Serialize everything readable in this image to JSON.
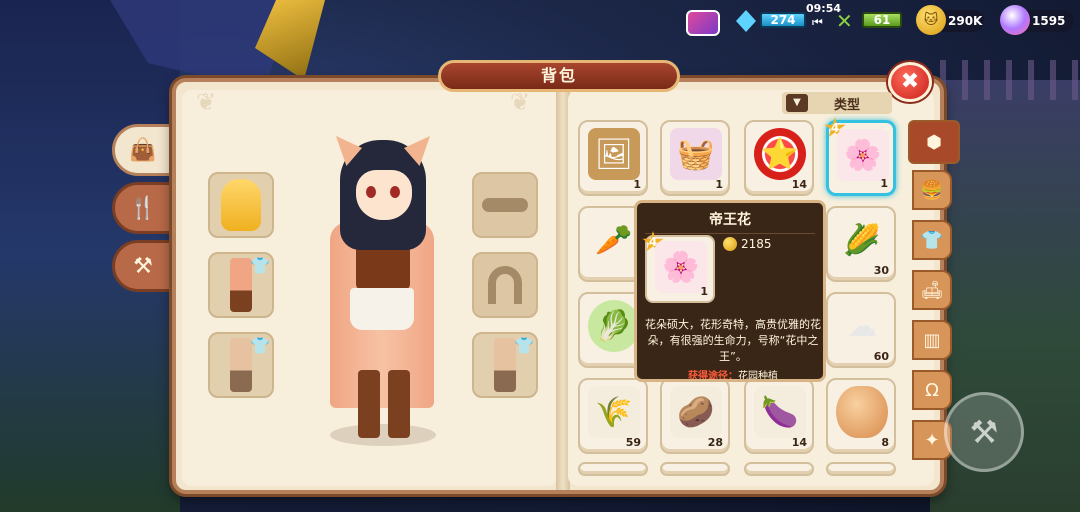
{
  "hud": {
    "energy": "274",
    "time": "09:54",
    "food": "61",
    "gold": "290K",
    "gems": "1595"
  },
  "window": {
    "title": "背包",
    "close_symbol": "✖",
    "type_filter_label": "类型"
  },
  "left_categories": [
    {
      "name": "bag",
      "icon": "bag-icon",
      "glyph": "👜"
    },
    {
      "name": "food",
      "icon": "utensils-icon",
      "glyph": "🍴"
    },
    {
      "name": "tools",
      "icon": "anvil-icon",
      "glyph": "⚒"
    }
  ],
  "equipment": {
    "hair_slot": "hair",
    "outfit_slot": "outfit",
    "outfit2_slot": "outfit",
    "glasses_slot": "glasses",
    "accessory_slot": "horseshoe",
    "outfit3_slot": "outfit"
  },
  "items": [
    {
      "name": "certificate",
      "icon": "frame-icon",
      "glyph": "🖼",
      "count": "1"
    },
    {
      "name": "picnic",
      "icon": "picnic-icon",
      "glyph": "🧺",
      "count": "1"
    },
    {
      "name": "badge",
      "icon": "badge-icon",
      "glyph": "⭐",
      "count": "14"
    },
    {
      "name": "peony",
      "icon": "peony-icon",
      "glyph": "🌸",
      "count": "1",
      "stars": "4"
    },
    {
      "name": "carrot",
      "icon": "carrot-icon",
      "glyph": "🥕",
      "count": ""
    },
    {
      "name": "corn",
      "icon": "corn-icon",
      "glyph": "🌽",
      "count": "30"
    },
    {
      "name": "cabbage",
      "icon": "cabbage-icon",
      "glyph": "🥬",
      "count": ""
    },
    {
      "name": "cotton",
      "icon": "cotton-icon",
      "glyph": "☁",
      "count": "60"
    },
    {
      "name": "wheat-seed",
      "icon": "wheat-icon",
      "glyph": "🌾",
      "count": "59"
    },
    {
      "name": "potato-seed",
      "icon": "potato-icon",
      "glyph": "🥔",
      "count": "28"
    },
    {
      "name": "eggplant-seed",
      "icon": "eggplant-icon",
      "glyph": "🍆",
      "count": "14"
    },
    {
      "name": "egg",
      "icon": "egg-icon",
      "glyph": "🥚",
      "count": "8"
    }
  ],
  "side_tabs": [
    {
      "name": "all",
      "icon": "box-icon",
      "glyph": "⬢"
    },
    {
      "name": "food",
      "icon": "burger-icon",
      "glyph": "🍔"
    },
    {
      "name": "clothes",
      "icon": "shirt-icon",
      "glyph": "👕"
    },
    {
      "name": "furniture",
      "icon": "chair-icon",
      "glyph": "🛋"
    },
    {
      "name": "fence",
      "icon": "fence-icon",
      "glyph": "▥"
    },
    {
      "name": "horseshoe",
      "icon": "horseshoe-icon",
      "glyph": "Ω"
    },
    {
      "name": "special",
      "icon": "star-icon",
      "glyph": "✦"
    }
  ],
  "tooltip": {
    "title": "帝王花",
    "price": "2185",
    "stars": "4",
    "count": "1",
    "description": "花朵硕大，花形奇特，高贵优雅的花朵，有很强的生命力，号称“花中之王”。",
    "source_label": "获得途径：",
    "source_value": "花园种植"
  },
  "colors": {
    "panel_bg": "#f3e6cf",
    "accent_red": "#c8201a",
    "selected_border": "#34c2e0",
    "star_gold": "#f4b020"
  }
}
